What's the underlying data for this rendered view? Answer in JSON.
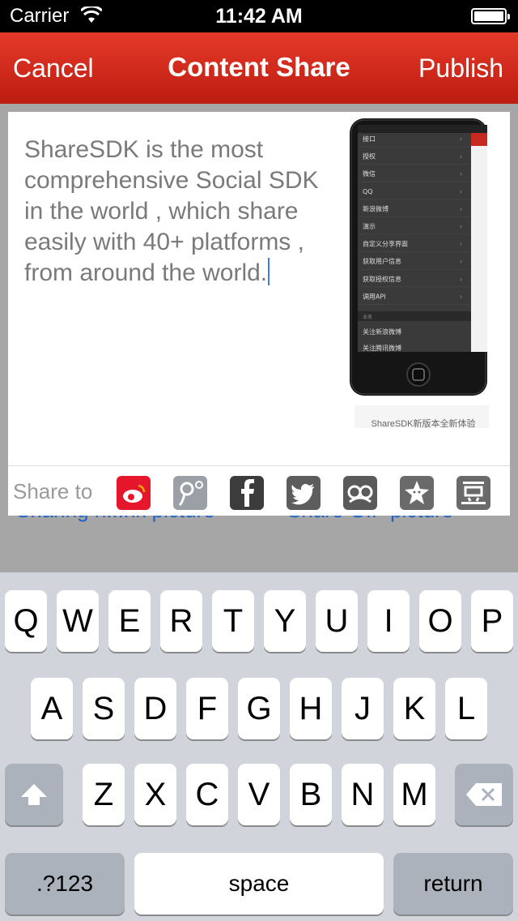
{
  "status_bar": {
    "carrier": "Carrier",
    "time": "11:42 AM"
  },
  "nav": {
    "cancel": "Cancel",
    "title": "Content Share",
    "publish": "Publish"
  },
  "background_links": [
    "Sharing n...nk picture",
    "Share GIF picture"
  ],
  "post": {
    "text": "ShareSDK is the most comprehensive Social SDK in the world , which share easily with 40+ platforms , from around the world."
  },
  "preview": {
    "caption": "ShareSDK新版本全新体验",
    "menu_items": [
      "接口",
      "授权",
      "微信",
      "QQ",
      "新浪微博",
      "演示",
      "自定义分享界面",
      "获取用户信息",
      "获取授权信息",
      "调用API"
    ],
    "section_label": "业务",
    "section_items": [
      "关注新浪微博",
      "关注腾讯微博"
    ]
  },
  "share": {
    "label": "Share to",
    "platforms": [
      {
        "name": "sina-weibo-icon",
        "color": "#e6162d"
      },
      {
        "name": "tencent-weibo-icon",
        "color": "#9aa0a6"
      },
      {
        "name": "facebook-icon",
        "color": "#3c3c3c"
      },
      {
        "name": "twitter-icon",
        "color": "#5d5d5d"
      },
      {
        "name": "renren-icon",
        "color": "#5a5a5a"
      },
      {
        "name": "qzone-icon",
        "color": "#6a6a6a"
      },
      {
        "name": "douban-icon",
        "color": "#6a6a6a"
      }
    ]
  },
  "keyboard": {
    "row1": [
      "Q",
      "W",
      "E",
      "R",
      "T",
      "Y",
      "U",
      "I",
      "O",
      "P"
    ],
    "row2": [
      "A",
      "S",
      "D",
      "F",
      "G",
      "H",
      "J",
      "K",
      "L"
    ],
    "row3": [
      "Z",
      "X",
      "C",
      "V",
      "B",
      "N",
      "M"
    ],
    "numbers": ".?123",
    "space": "space",
    "return": "return"
  }
}
